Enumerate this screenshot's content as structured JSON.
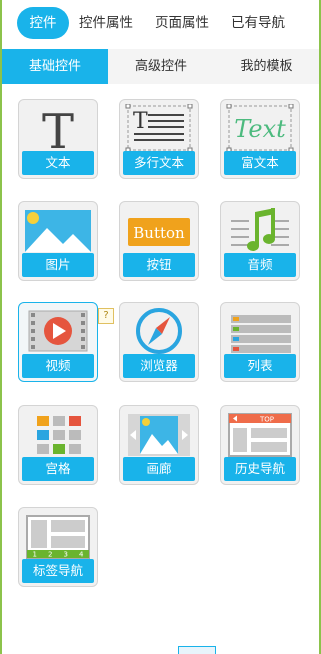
{
  "top_tabs": [
    "控件",
    "控件属性",
    "页面属性",
    "已有导航"
  ],
  "sub_tabs": [
    "基础控件",
    "高级控件",
    "我的模板"
  ],
  "controls": [
    {
      "label": "文本",
      "icon": "text-icon"
    },
    {
      "label": "多行文本",
      "icon": "multiline-text-icon"
    },
    {
      "label": "富文本",
      "icon": "rich-text-icon"
    },
    {
      "label": "图片",
      "icon": "image-icon"
    },
    {
      "label": "按钮",
      "icon": "button-icon"
    },
    {
      "label": "音频",
      "icon": "audio-icon"
    },
    {
      "label": "视频",
      "icon": "video-icon"
    },
    {
      "label": "浏览器",
      "icon": "browser-icon"
    },
    {
      "label": "列表",
      "icon": "list-icon"
    },
    {
      "label": "宫格",
      "icon": "grid-icon"
    },
    {
      "label": "画廊",
      "icon": "gallery-icon"
    },
    {
      "label": "历史导航",
      "icon": "history-nav-icon"
    },
    {
      "label": "标签导航",
      "icon": "tab-nav-icon"
    }
  ],
  "glyphs": {
    "text_T": "T",
    "rich_text": "Text",
    "button_word": "Button",
    "help_mark": "?",
    "history_top": "TOP",
    "tab_numbers": [
      "1",
      "2",
      "3",
      "4"
    ]
  },
  "colors": {
    "accent": "#19b3ea",
    "frame": "#8cc34b"
  }
}
